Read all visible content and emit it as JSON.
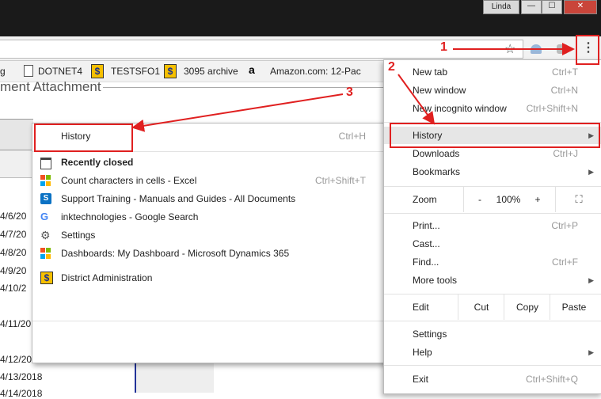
{
  "window": {
    "user": "Linda",
    "controls": [
      "—",
      "☐",
      "✕"
    ]
  },
  "bookmarks": {
    "items": [
      {
        "label": "g"
      },
      {
        "label": "DOTNET4"
      },
      {
        "label": "TESTSFO1"
      },
      {
        "label": "3095 archive"
      },
      {
        "label": "Amazon.com: 12-Pac"
      }
    ]
  },
  "page": {
    "heading": "ment Attachment",
    "dates": [
      "4/6/20",
      "4/7/20",
      "4/8/20",
      "4/9/20",
      "4/10/2",
      "4/11/20",
      "4/12/20",
      "4/13/2018",
      "4/14/2018"
    ]
  },
  "history_menu": {
    "history_label": "History",
    "history_shortcut": "Ctrl+H",
    "recently_closed": "Recently closed",
    "items": [
      {
        "label": "Count characters in cells - Excel",
        "shortcut": "Ctrl+Shift+T",
        "icon": "microsoft-icon"
      },
      {
        "label": "Support  Training - Manuals and Guides - All Documents",
        "icon": "sharepoint-icon"
      },
      {
        "label": "inktechnologies - Google Search",
        "icon": "google-icon"
      },
      {
        "label": "Settings",
        "icon": "gear-icon"
      },
      {
        "label": "Dashboards: My Dashboard - Microsoft Dynamics 365",
        "icon": "microsoft-icon"
      },
      {
        "label": "District Administration",
        "icon": "dollar-icon"
      }
    ]
  },
  "main_menu": {
    "new_tab": "New tab",
    "new_tab_sc": "Ctrl+T",
    "new_window": "New window",
    "new_window_sc": "Ctrl+N",
    "incognito": "New incognito window",
    "incognito_sc": "Ctrl+Shift+N",
    "history": "History",
    "downloads": "Downloads",
    "downloads_sc": "Ctrl+J",
    "bookmarks": "Bookmarks",
    "zoom": "Zoom",
    "zoom_minus": "-",
    "zoom_value": "100%",
    "zoom_plus": "+",
    "print": "Print...",
    "print_sc": "Ctrl+P",
    "cast": "Cast...",
    "find": "Find...",
    "find_sc": "Ctrl+F",
    "more_tools": "More tools",
    "edit": "Edit",
    "cut": "Cut",
    "copy": "Copy",
    "paste": "Paste",
    "settings": "Settings",
    "help": "Help",
    "exit": "Exit",
    "exit_sc": "Ctrl+Shift+Q"
  },
  "annotations": {
    "one": "1",
    "two": "2",
    "three": "3",
    "color": "#e02020"
  }
}
